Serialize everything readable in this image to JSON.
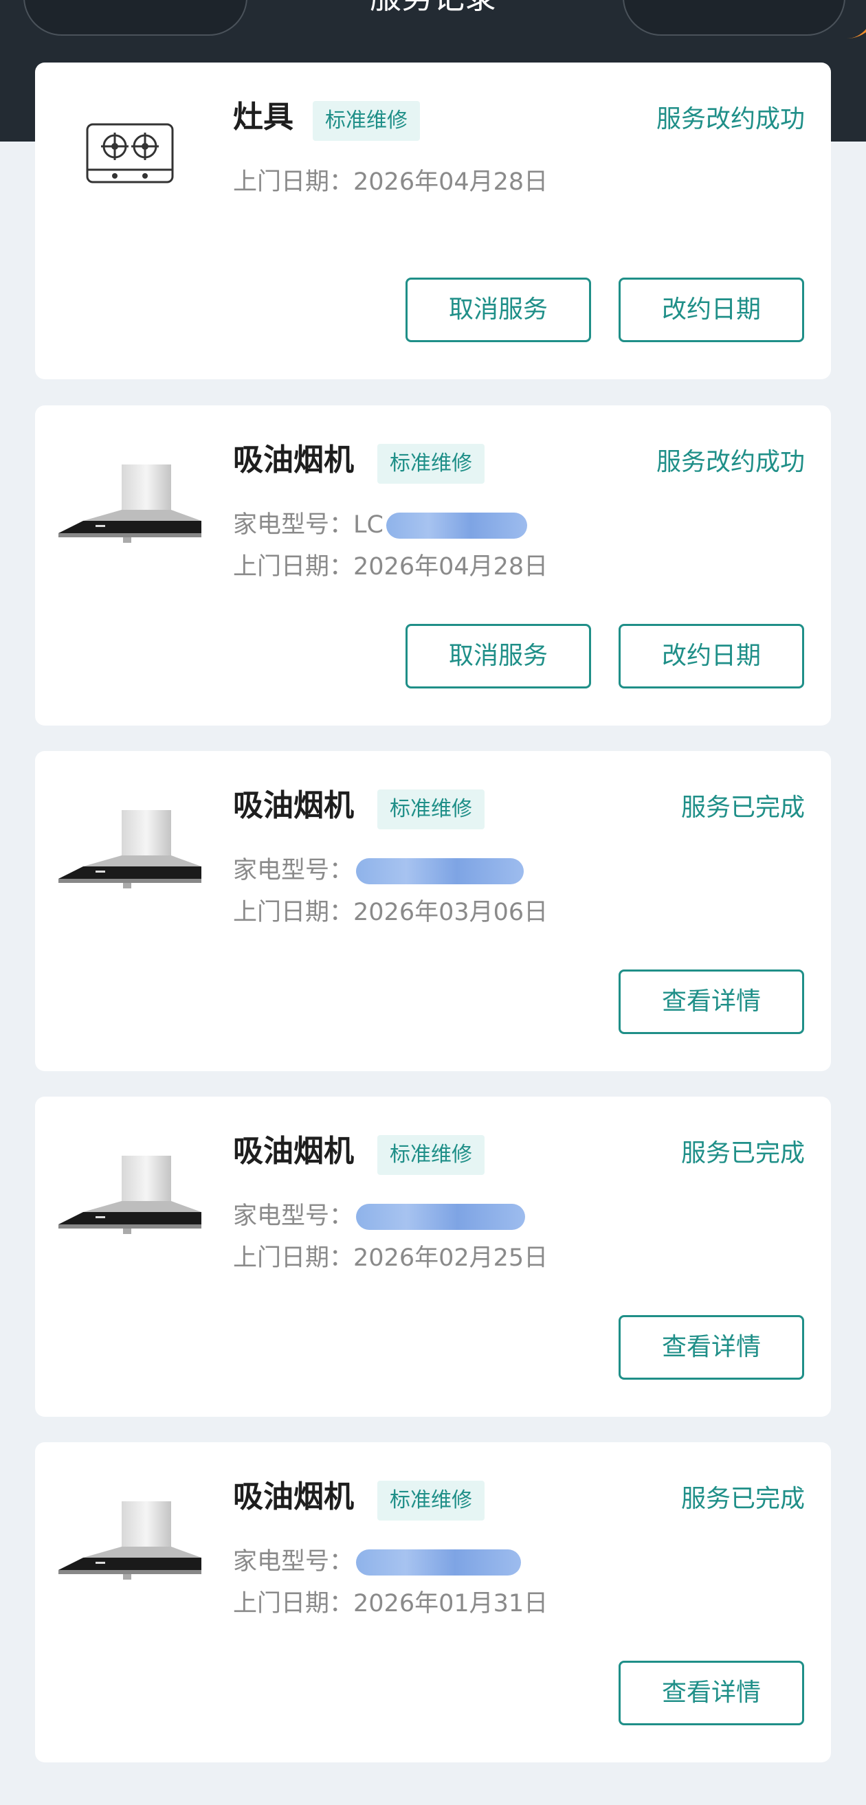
{
  "header": {
    "title": "服务记录",
    "left_icons": [
      "back-icon",
      "home-icon"
    ],
    "right_icons": [
      "more-icon",
      "target-icon"
    ],
    "colors": {
      "bg": "#232b33",
      "accent": "#1f8f88",
      "orange": "#ef8a2a"
    }
  },
  "records": [
    {
      "title": "灶具",
      "tag": "标准维修",
      "status": "服务改约成功",
      "image": "gas-stove-icon",
      "model_label": null,
      "model_prefix": null,
      "date_label": "上门日期：",
      "date": "2026年04月28日",
      "buttons": [
        "取消服务",
        "改约日期"
      ]
    },
    {
      "title": "吸油烟机",
      "tag": "标准维修",
      "status": "服务改约成功",
      "image": "range-hood-icon",
      "model_label": "家电型号：",
      "model_prefix": "LC",
      "date_label": "上门日期：",
      "date": "2026年04月28日",
      "buttons": [
        "取消服务",
        "改约日期"
      ]
    },
    {
      "title": "吸油烟机",
      "tag": "标准维修",
      "status": "服务已完成",
      "image": "range-hood-icon",
      "model_label": "家电型号：",
      "model_prefix": "",
      "date_label": "上门日期：",
      "date": "2026年03月06日",
      "buttons": [
        "查看详情"
      ]
    },
    {
      "title": "吸油烟机",
      "tag": "标准维修",
      "status": "服务已完成",
      "image": "range-hood-icon",
      "model_label": "家电型号：",
      "model_prefix": "",
      "date_label": "上门日期：",
      "date": "2026年02月25日",
      "buttons": [
        "查看详情"
      ]
    },
    {
      "title": "吸油烟机",
      "tag": "标准维修",
      "status": "服务已完成",
      "image": "range-hood-icon",
      "model_label": "家电型号：",
      "model_prefix": "",
      "date_label": "上门日期：",
      "date": "2026年01月31日",
      "buttons": [
        "查看详情"
      ]
    }
  ]
}
